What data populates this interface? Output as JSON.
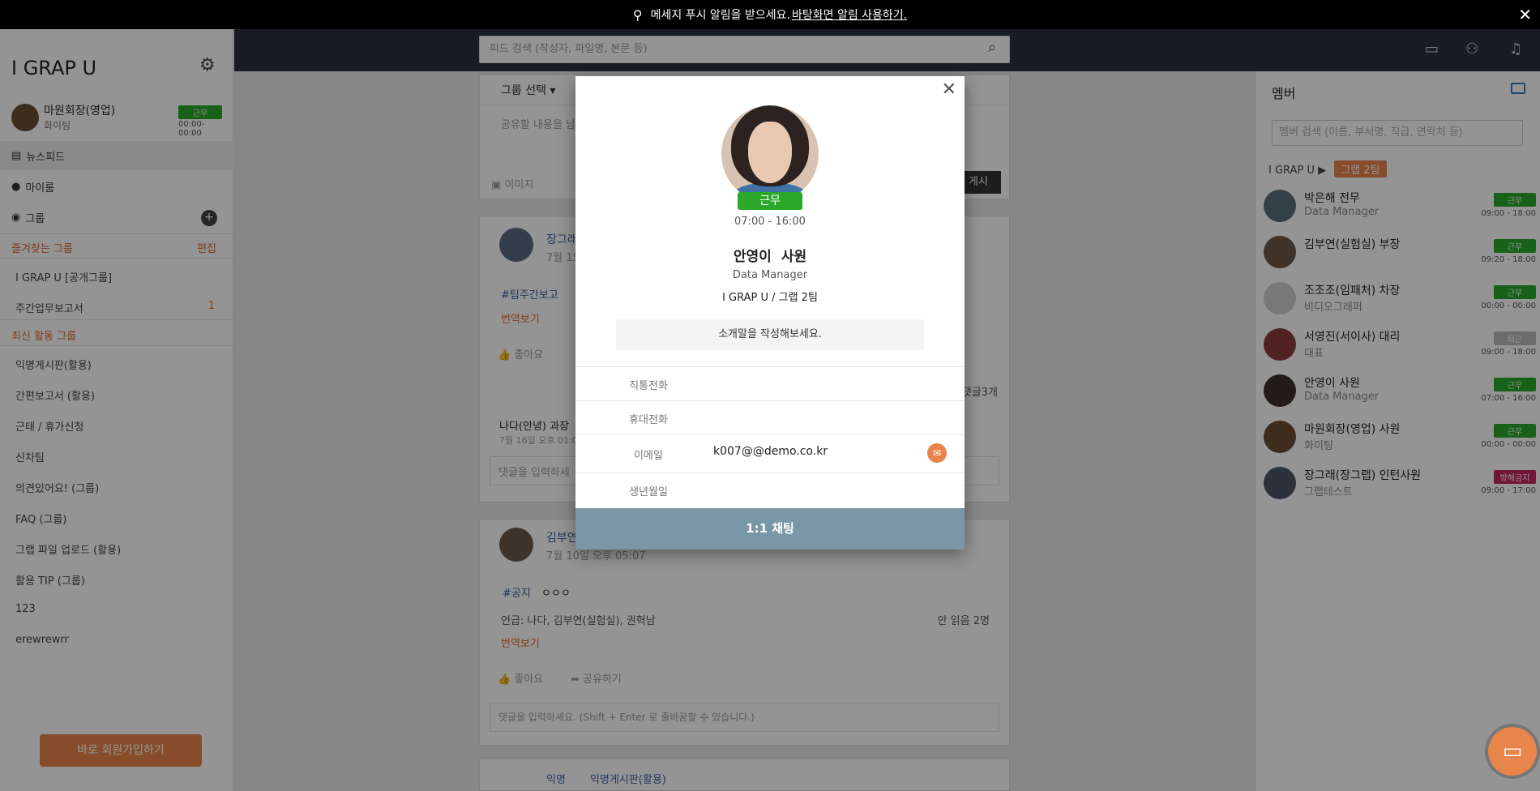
{
  "banner": {
    "text": "메세지 푸시 알림을 받으세요.",
    "link": "바탕화면 알림 사용하기.",
    "close": "✕"
  },
  "sidebar": {
    "brand": "I GRAP U",
    "user": {
      "name": "마원회장(영업)",
      "sub": "화이팅",
      "status": "근무",
      "hours": "00:00-00:00"
    },
    "nav": [
      {
        "label": "뉴스피드"
      },
      {
        "label": "마이룸"
      },
      {
        "label": "그룹"
      }
    ],
    "favorites_title": "즐겨찾는 그룹",
    "edit_label": "편집",
    "favorites": [
      {
        "label": "I GRAP U [공개그룹]",
        "count": ""
      },
      {
        "label": "주간업무보고서",
        "count": "1"
      }
    ],
    "recent_title": "최신 활동 그룹",
    "recent": [
      {
        "label": "익명게시판(활용)"
      },
      {
        "label": "간편보고서 (활용)"
      },
      {
        "label": "근태 / 휴가신청"
      },
      {
        "label": "신차팀"
      },
      {
        "label": "의견있어요! (그룹)"
      },
      {
        "label": "FAQ (그룹)"
      },
      {
        "label": "그랩 파일 업로드 (활용)"
      },
      {
        "label": "활용 TIP (그룹)"
      },
      {
        "label": "123"
      },
      {
        "label": "erewrewrr"
      }
    ],
    "join_label": "바로 회원가입하기"
  },
  "header": {
    "search_placeholder": "피드 검색 (작성자, 파일명, 본문 등)"
  },
  "feed": {
    "group_select": "그룹 선택 ▾",
    "compose_placeholder": "공유할 내용을 남기",
    "image_label": "이미지",
    "post_label": "게시",
    "post1": {
      "author": "장그래",
      "date": "7월 15",
      "tag": "#팀주간보고",
      "translate": "번역보기",
      "like": "좋아요",
      "comments": "댓글3개",
      "commenter": "나다(안녕) 과장",
      "comment_date": "7월 16일 오후 01:0",
      "comment_placeholder": "댓글을 입력하세"
    },
    "post2": {
      "author": "김부연",
      "date": "7월 10일 오후 05:07",
      "tag": "#공지",
      "content": "ㅇㅇㅇ",
      "mention": "언급: 나다, 김부연(실험실), 권혁남",
      "unread": "안 읽음 2명",
      "translate": "번역보기",
      "like": "좋아요",
      "share": "공유하기",
      "comment_placeholder": "댓글을 입력하세요. (Shift + Enter 로 줄바꿈할 수 있습니다.)"
    },
    "post3": {
      "author": "익명",
      "group": "익명게시판(활용)"
    }
  },
  "members": {
    "title": "멤버",
    "search_placeholder": "멤버 검색 (이름, 부서명, 직급, 연락처 등)",
    "crumb_root": "I GRAP U",
    "crumb_tag": "그랩 2팀",
    "list": [
      {
        "name": "박은해 전무",
        "role": "Data Manager",
        "status": "근무",
        "status_color": "#2aa82a",
        "hours": "09:00 - 18:00"
      },
      {
        "name": "김부연(실험실) 부장",
        "role": "",
        "status": "근무",
        "status_color": "#2aa82a",
        "hours": "09:20 - 18:00"
      },
      {
        "name": "조조조(임패처) 차장",
        "role": "비디오그래퍼",
        "status": "근무",
        "status_color": "#2aa82a",
        "hours": "00:00 - 00:00"
      },
      {
        "name": "서영진(서이사) 대리",
        "role": "대표",
        "status": "퇴근",
        "status_color": "#bbbbbb",
        "hours": "09:00 - 18:00"
      },
      {
        "name": "안영이 사원",
        "role": "Data Manager",
        "status": "근무",
        "status_color": "#2aa82a",
        "hours": "07:00 - 16:00"
      },
      {
        "name": "마원회장(영업) 사원",
        "role": "화이팅",
        "status": "근무",
        "status_color": "#2aa82a",
        "hours": "00:00 - 00:00"
      },
      {
        "name": "장그래(장그랩) 인턴사원",
        "role": "그랩테스트",
        "status": "방해금지",
        "status_color": "#c4245e",
        "hours": "09:00 - 17:00"
      }
    ]
  },
  "modal": {
    "status": "근무",
    "hours": "07:00 - 16:00",
    "name": "안영이",
    "title": "사원",
    "dept": "Data Manager",
    "team": "I GRAP U / 그랩 2팀",
    "intro": "소개말을 작성해보세요.",
    "fields": {
      "direct_phone_label": "직통전화",
      "direct_phone": "",
      "mobile_label": "휴대전화",
      "mobile": "",
      "email_label": "이메일",
      "email": "k007@@demo.co.kr",
      "birth_label": "생년월일",
      "birth": ""
    },
    "chat_label": "1:1 채팅",
    "close": "✕"
  },
  "colors": {
    "accent": "#e8854b",
    "status_work": "#2aa82a",
    "header_bg": "#2c333c",
    "chat_btn": "#7a97a8"
  }
}
